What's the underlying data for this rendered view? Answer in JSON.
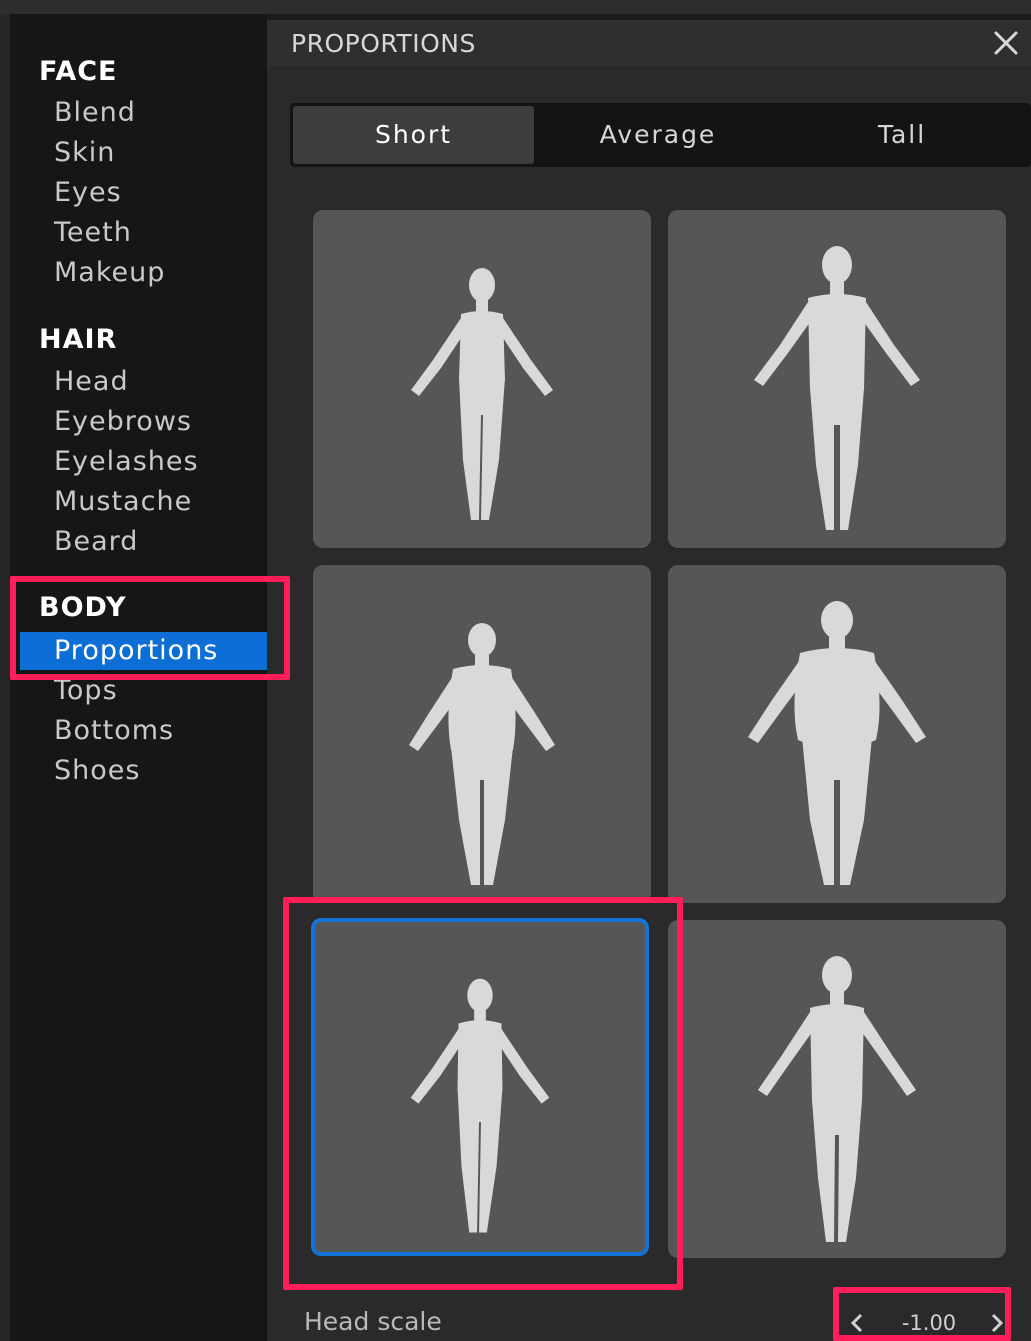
{
  "sidebar": {
    "sections": [
      {
        "title": "FACE",
        "items": [
          "Blend",
          "Skin",
          "Eyes",
          "Teeth",
          "Makeup"
        ]
      },
      {
        "title": "HAIR",
        "items": [
          "Head",
          "Eyebrows",
          "Eyelashes",
          "Mustache",
          "Beard"
        ]
      },
      {
        "title": "BODY",
        "items": [
          "Proportions",
          "Tops",
          "Bottoms",
          "Shoes"
        ]
      }
    ],
    "active_item": "Proportions"
  },
  "panel": {
    "title": "PROPORTIONS",
    "close_icon": "close-icon",
    "tabs": [
      "Short",
      "Average",
      "Tall"
    ],
    "active_tab": "Short",
    "presets": [
      "body-female-slim",
      "body-male-slim",
      "body-female-heavy",
      "body-male-heavy",
      "body-female-athletic",
      "body-male-athletic"
    ],
    "selected_preset_index": 4,
    "head_scale": {
      "label": "Head scale",
      "value": "-1.00",
      "prev_icon": "chevron-left-icon",
      "next_icon": "chevron-right-icon"
    }
  },
  "colors": {
    "accent": "#0d6fd6",
    "annotation": "#ff1e5a",
    "card_bg": "#565656",
    "figure": "#d9d9d9"
  }
}
